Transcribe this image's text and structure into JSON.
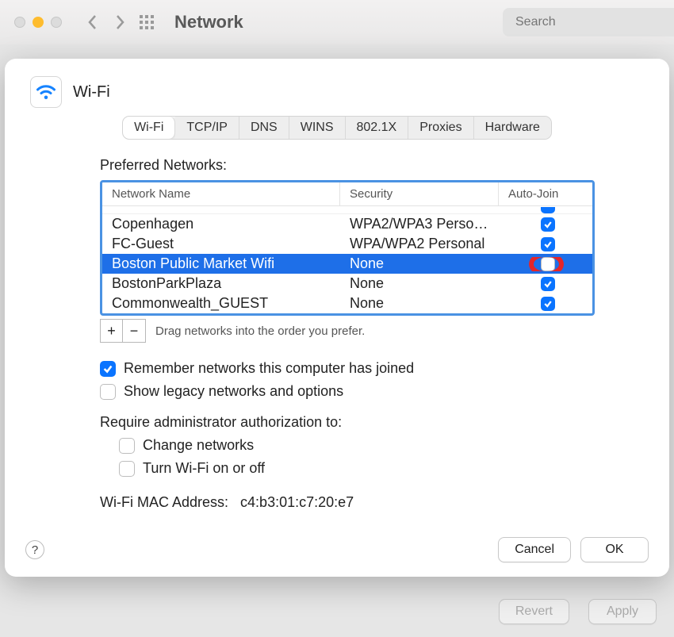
{
  "window": {
    "title": "Network",
    "search_placeholder": "Search"
  },
  "panel": {
    "icon_name": "wifi-icon",
    "title": "Wi-Fi"
  },
  "tabs": [
    {
      "label": "Wi-Fi",
      "active": true
    },
    {
      "label": "TCP/IP",
      "active": false
    },
    {
      "label": "DNS",
      "active": false
    },
    {
      "label": "WINS",
      "active": false
    },
    {
      "label": "802.1X",
      "active": false
    },
    {
      "label": "Proxies",
      "active": false
    },
    {
      "label": "Hardware",
      "active": false
    }
  ],
  "preferred_label": "Preferred Networks:",
  "table": {
    "columns": [
      "Network Name",
      "Security",
      "Auto-Join"
    ],
    "rows": [
      {
        "name": "Copenhagen",
        "security": "WPA2/WPA3 Personal",
        "autojoin": true,
        "selected": false
      },
      {
        "name": "FC-Guest",
        "security": "WPA/WPA2 Personal",
        "autojoin": true,
        "selected": false
      },
      {
        "name": "Boston Public Market Wifi",
        "security": "None",
        "autojoin": false,
        "selected": true,
        "highlight": true
      },
      {
        "name": "BostonParkPlaza",
        "security": "None",
        "autojoin": true,
        "selected": false
      },
      {
        "name": "Commonwealth_GUEST",
        "security": "None",
        "autojoin": true,
        "selected": false
      }
    ]
  },
  "addremove": {
    "add": "+",
    "remove": "−",
    "hint": "Drag networks into the order you prefer."
  },
  "options": {
    "remember": {
      "label": "Remember networks this computer has joined",
      "checked": true
    },
    "legacy": {
      "label": "Show legacy networks and options",
      "checked": false
    }
  },
  "auth": {
    "heading": "Require administrator authorization to:",
    "items": [
      {
        "label": "Change networks",
        "checked": false
      },
      {
        "label": "Turn Wi-Fi on or off",
        "checked": false
      }
    ]
  },
  "mac": {
    "label": "Wi-Fi MAC Address:",
    "value": "c4:b3:01:c7:20:e7"
  },
  "sheet_buttons": {
    "help": "?",
    "cancel": "Cancel",
    "ok": "OK"
  },
  "window_buttons": {
    "revert": "Revert",
    "apply": "Apply"
  }
}
